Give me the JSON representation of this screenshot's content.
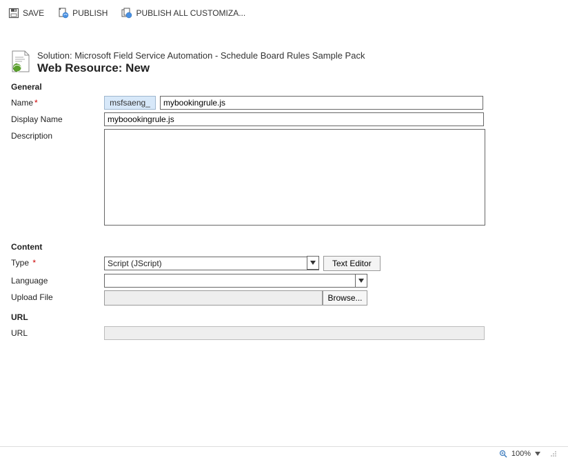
{
  "toolbar": {
    "save": "SAVE",
    "publish": "PUBLISH",
    "publish_all": "PUBLISH ALL CUSTOMIZA..."
  },
  "header": {
    "solution": "Solution: Microsoft Field Service Automation - Schedule Board Rules Sample Pack",
    "title": "Web Resource: New"
  },
  "sections": {
    "general": "General",
    "content": "Content",
    "url": "URL"
  },
  "general": {
    "labels": {
      "name": "Name",
      "display_name": "Display Name",
      "description": "Description"
    },
    "name_prefix": "msfsaeng_",
    "name_value": "mybookingrule.js",
    "display_name_value": "myboookingrule.js",
    "description_value": ""
  },
  "content": {
    "labels": {
      "type": "Type",
      "language": "Language",
      "upload_file": "Upload File"
    },
    "type_value": "Script (JScript)",
    "text_editor_btn": "Text Editor",
    "language_value": "",
    "upload_path": "",
    "browse_btn": "Browse..."
  },
  "url": {
    "label": "URL",
    "value": ""
  },
  "statusbar": {
    "zoom": "100%"
  }
}
